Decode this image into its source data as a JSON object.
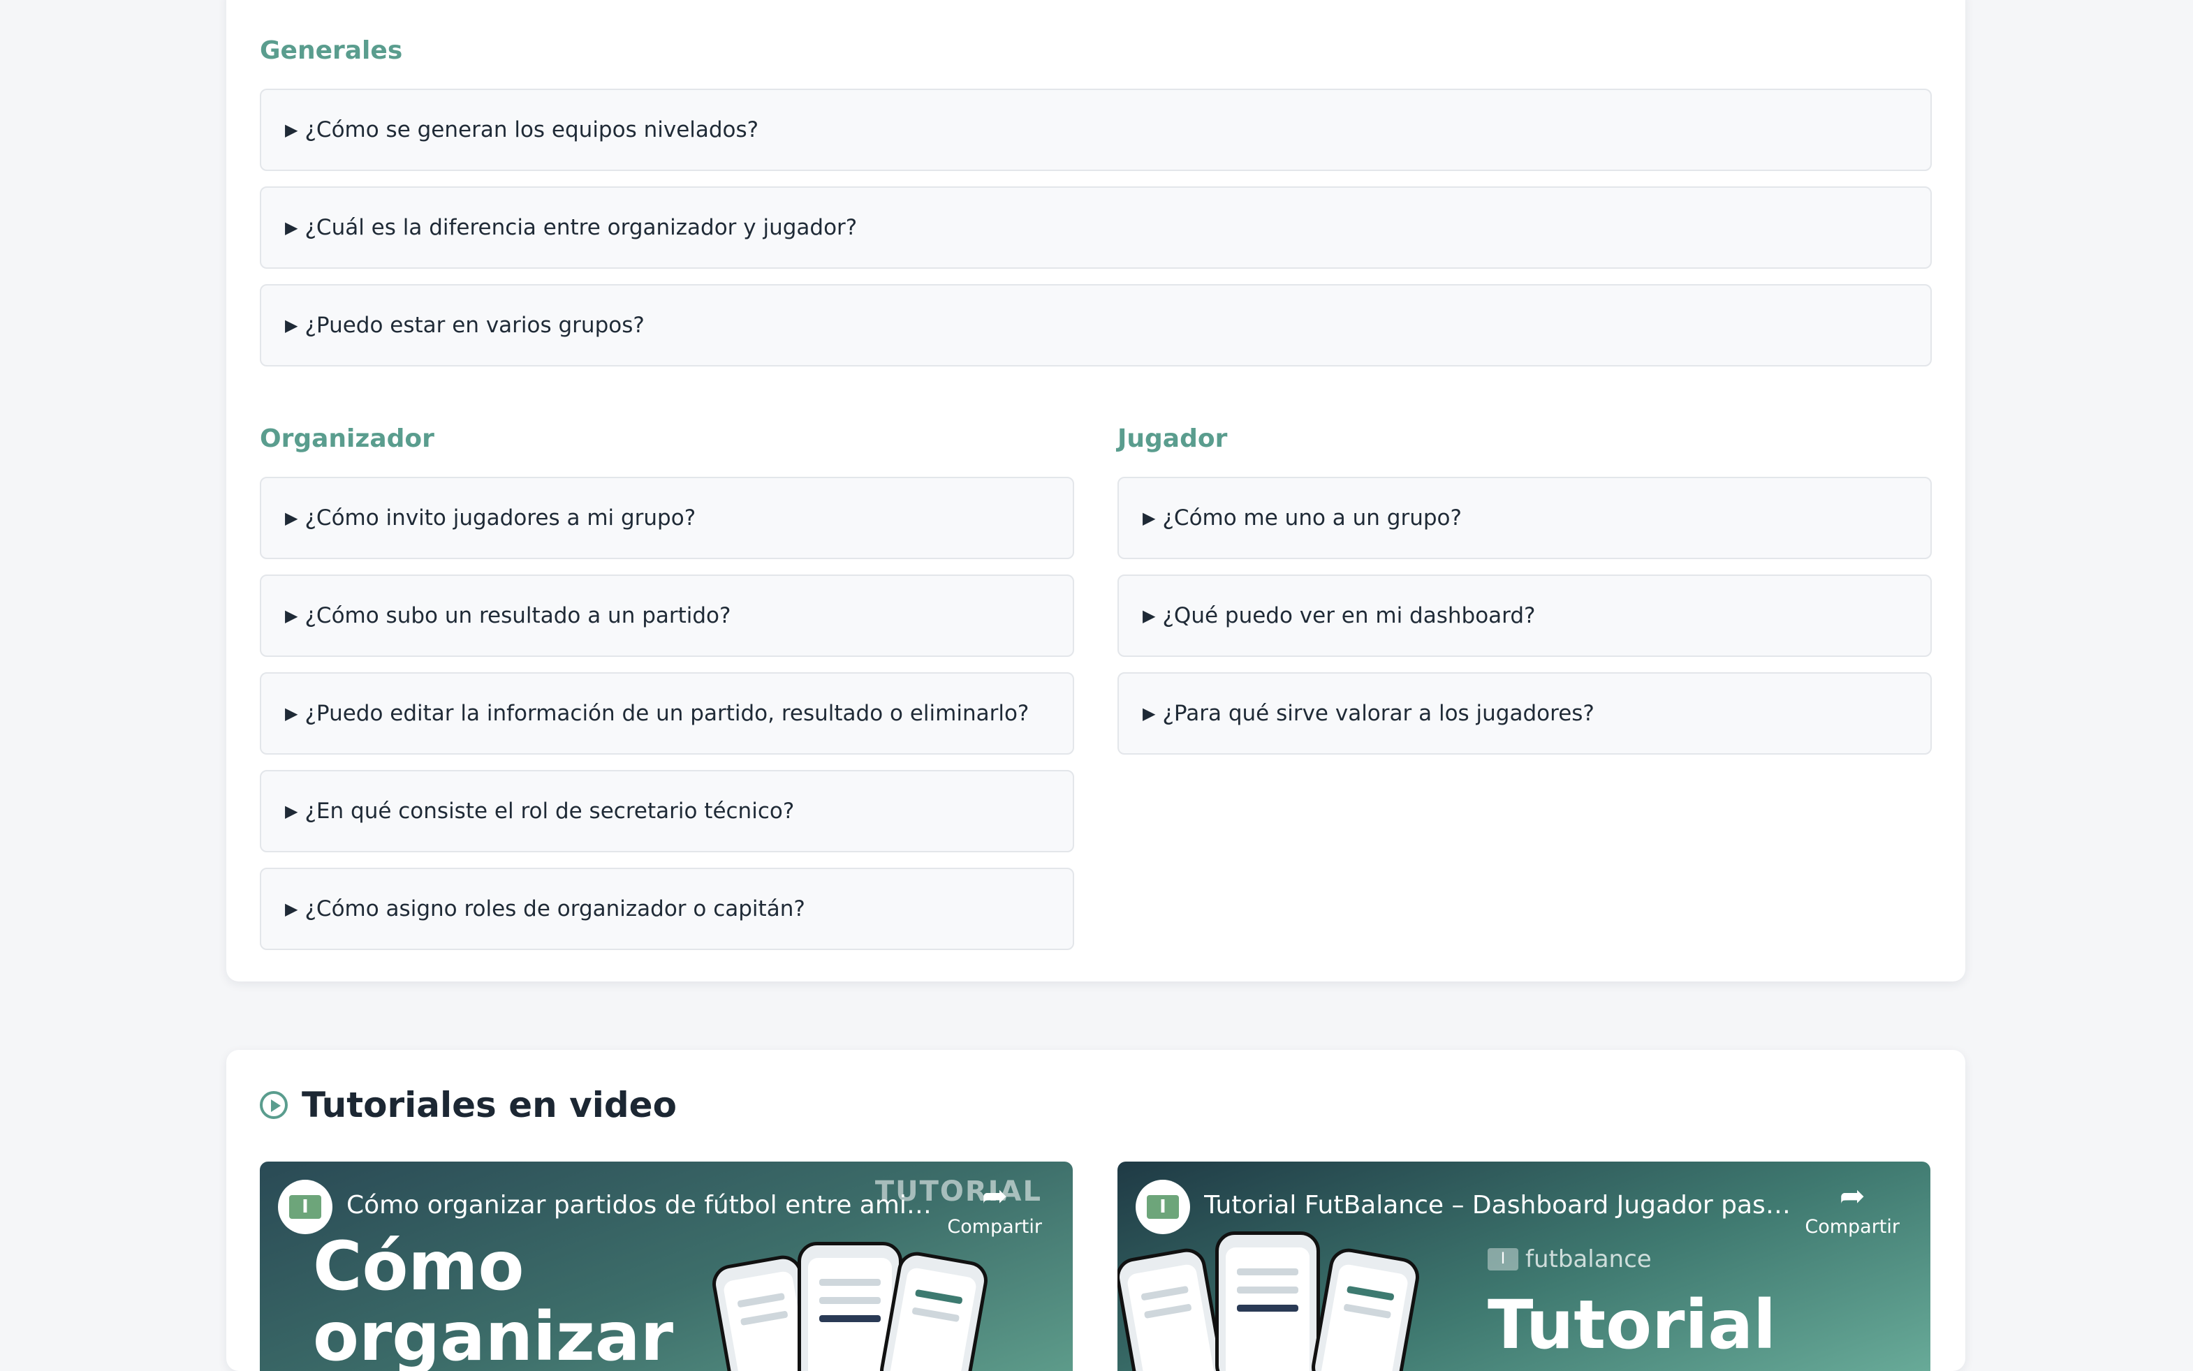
{
  "faq": {
    "generales": {
      "title": "Generales",
      "items": [
        "¿Cómo se generan los equipos nivelados?",
        "¿Cuál es la diferencia entre organizador y jugador?",
        "¿Puedo estar en varios grupos?"
      ]
    },
    "organizador": {
      "title": "Organizador",
      "items": [
        "¿Cómo invito jugadores a mi grupo?",
        "¿Cómo subo un resultado a un partido?",
        "¿Puedo editar la información de un partido, resultado o eliminarlo?",
        "¿En qué consiste el rol de secretario técnico?",
        "¿Cómo asigno roles de organizador o capitán?"
      ]
    },
    "jugador": {
      "title": "Jugador",
      "items": [
        "¿Cómo me uno a un grupo?",
        "¿Qué puedo ver en mi dashboard?",
        "¿Para qué sirve valorar a los jugadores?"
      ]
    },
    "expander_glyph": "▶"
  },
  "videos": {
    "title": "Tutoriales en video",
    "share_label": "Compartir",
    "items": [
      {
        "title": "Cómo organizar partidos de fútbol entre amigos co...",
        "overlay_line1": "Cómo",
        "overlay_line2": "organizar",
        "tag": "TUTORIAL"
      },
      {
        "title": "Tutorial FutBalance – Dashboard Jugador paso a p...",
        "brand": "futbalance",
        "overlay_word": "Tutorial"
      }
    ]
  },
  "colors": {
    "accent": "#5a9d8e",
    "item_bg": "#f8f9fb",
    "item_border": "#e3e6ea"
  }
}
